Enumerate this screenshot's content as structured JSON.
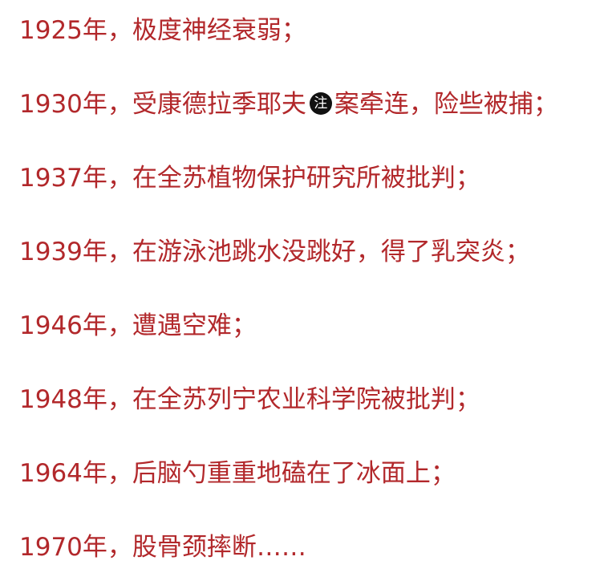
{
  "colors": {
    "text": "#b2282b",
    "background": "#ffffff",
    "note_badge_bg": "#111111",
    "note_badge_fg": "#ffffff"
  },
  "entries": [
    {
      "text": "1925年，极度神经衰弱；"
    },
    {
      "text_before": "1930年，受康德拉季耶夫",
      "note_badge": "注",
      "text_after": "案牵连，险些被捕；"
    },
    {
      "text": "1937年，在全苏植物保护研究所被批判；"
    },
    {
      "text": "1939年，在游泳池跳水没跳好，得了乳突炎；"
    },
    {
      "text": "1946年，遭遇空难；"
    },
    {
      "text": "1948年，在全苏列宁农业科学院被批判；"
    },
    {
      "text": "1964年，后脑勺重重地磕在了冰面上；"
    },
    {
      "text": "1970年，股骨颈摔断……"
    }
  ]
}
